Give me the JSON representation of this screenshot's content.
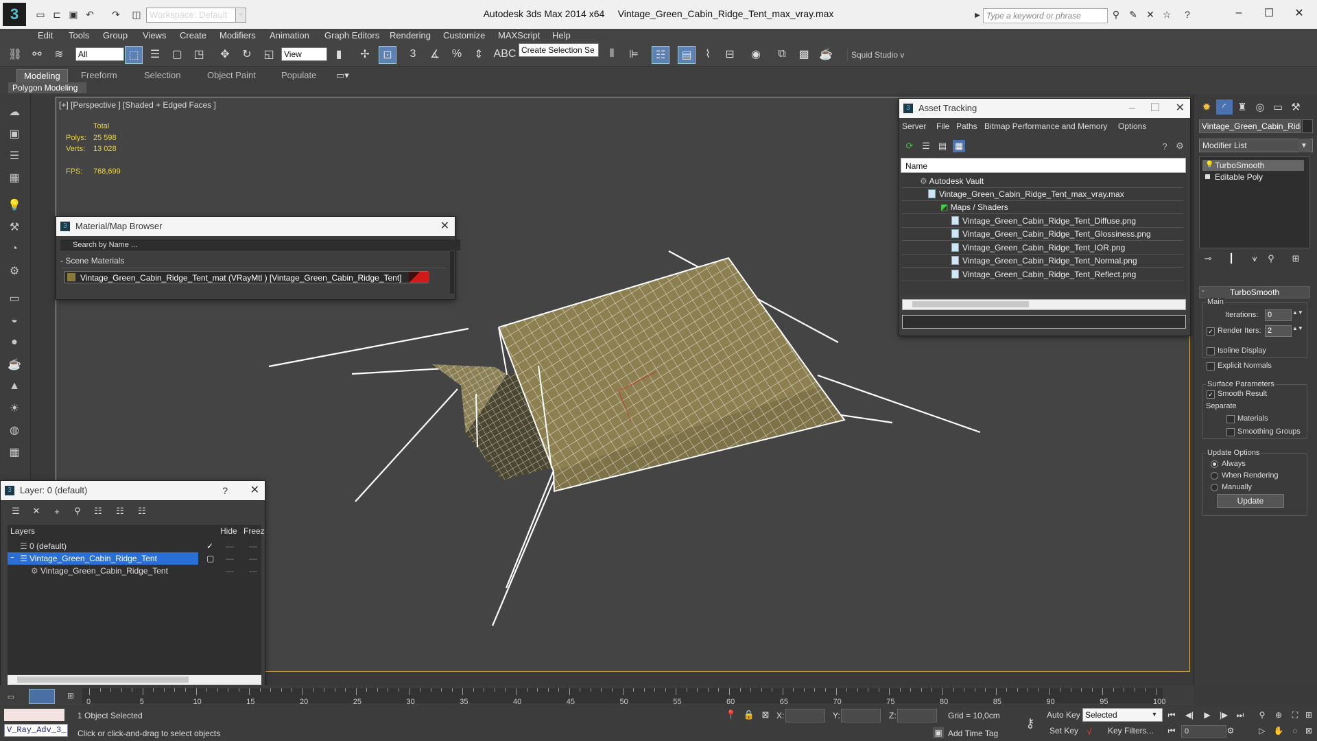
{
  "titlebar": {
    "app_title": "Autodesk 3ds Max  2014 x64",
    "file_title": "Vintage_Green_Cabin_Ridge_Tent_max_vray.max",
    "workspace": "Workspace: Default",
    "search_placeholder": "Type a keyword or phrase"
  },
  "menubar": {
    "items": [
      "Edit",
      "Tools",
      "Group",
      "Views",
      "Create",
      "Modifiers",
      "Animation",
      "Graph Editors",
      "Rendering",
      "Customize",
      "MAXScript",
      "Help"
    ]
  },
  "toolbar": {
    "filter": "All",
    "ref_coord": "View",
    "selection_set": "Create Selection Se",
    "squid": "Squid Studio v"
  },
  "ribbon": {
    "tabs": [
      "Modeling",
      "Freeform",
      "Selection",
      "Object Paint",
      "Populate"
    ],
    "panel": "Polygon Modeling"
  },
  "viewport": {
    "label": "[+] [Perspective ] [Shaded + Edged Faces ]",
    "total_label": "Total",
    "polys_label": "Polys:",
    "polys_value": "25 598",
    "verts_label": "Verts:",
    "verts_value": "13 028",
    "fps_label": "FPS:",
    "fps_value": "768,699"
  },
  "material_browser": {
    "title": "Material/Map Browser",
    "search_placeholder": "Search by Name ...",
    "group": "- Scene Materials",
    "material": "Vintage_Green_Cabin_Ridge_Tent_mat  (VRayMtl )  [Vintage_Green_Cabin_Ridge_Tent]"
  },
  "asset_tracking": {
    "title": "Asset Tracking",
    "menu": [
      "Server",
      "File",
      "Paths",
      "Bitmap Performance and Memory",
      "Options"
    ],
    "column": "Name",
    "tree": [
      "Autodesk Vault",
      "Vintage_Green_Cabin_Ridge_Tent_max_vray.max",
      "Maps / Shaders",
      "Vintage_Green_Cabin_Ridge_Tent_Diffuse.png",
      "Vintage_Green_Cabin_Ridge_Tent_Glossiness.png",
      "Vintage_Green_Cabin_Ridge_Tent_IOR.png",
      "Vintage_Green_Cabin_Ridge_Tent_Normal.png",
      "Vintage_Green_Cabin_Ridge_Tent_Reflect.png"
    ]
  },
  "layer_dialog": {
    "title": "Layer: 0 (default)",
    "col_layers": "Layers",
    "col_hide": "Hide",
    "col_freeze": "Freez",
    "rows": [
      "0 (default)",
      "Vintage_Green_Cabin_Ridge_Tent",
      "Vintage_Green_Cabin_Ridge_Tent"
    ]
  },
  "command_panel": {
    "object_name": "Vintage_Green_Cabin_Ridge_",
    "modifier_list": "Modifier List",
    "stack": [
      "TurboSmooth",
      "Editable Poly"
    ],
    "rollout": "TurboSmooth",
    "main": "Main",
    "iterations_label": "Iterations:",
    "iterations_value": "0",
    "render_iters_label": "Render Iters:",
    "render_iters_value": "2",
    "isoline": "Isoline Display",
    "explicit_normals": "Explicit Normals",
    "surface_params": "Surface Parameters",
    "smooth_result": "Smooth Result",
    "separate": "Separate",
    "materials": "Materials",
    "smoothing_groups": "Smoothing Groups",
    "update_options": "Update Options",
    "always": "Always",
    "when_rendering": "When Rendering",
    "manually": "Manually",
    "update_button": "Update"
  },
  "timeline": {
    "slider": "0 / 100",
    "ticks": [
      "0",
      "5",
      "10",
      "15",
      "20",
      "25",
      "30",
      "35",
      "40",
      "45",
      "50",
      "55",
      "60",
      "65",
      "70",
      "75",
      "80",
      "85",
      "90",
      "95",
      "100"
    ]
  },
  "status": {
    "script_label": "V_Ray_Adv_3_",
    "selected": "1 Object Selected",
    "prompt": "Click or click-and-drag to select objects",
    "x_label": "X:",
    "y_label": "Y:",
    "z_label": "Z:",
    "grid": "Grid = 10,0cm",
    "add_time_tag": "Add Time Tag",
    "auto_key": "Auto Key",
    "set_key": "Set Key",
    "selected_mode": "Selected",
    "key_filters": "Key Filters...",
    "frame": "0"
  },
  "colors": {
    "viewport_bg": "#444444",
    "mesh_fill": "#8c8050",
    "wire": "#ffffff",
    "selection_highlight": "#2a6fd6",
    "stat_yellow": "#e8d24a"
  }
}
